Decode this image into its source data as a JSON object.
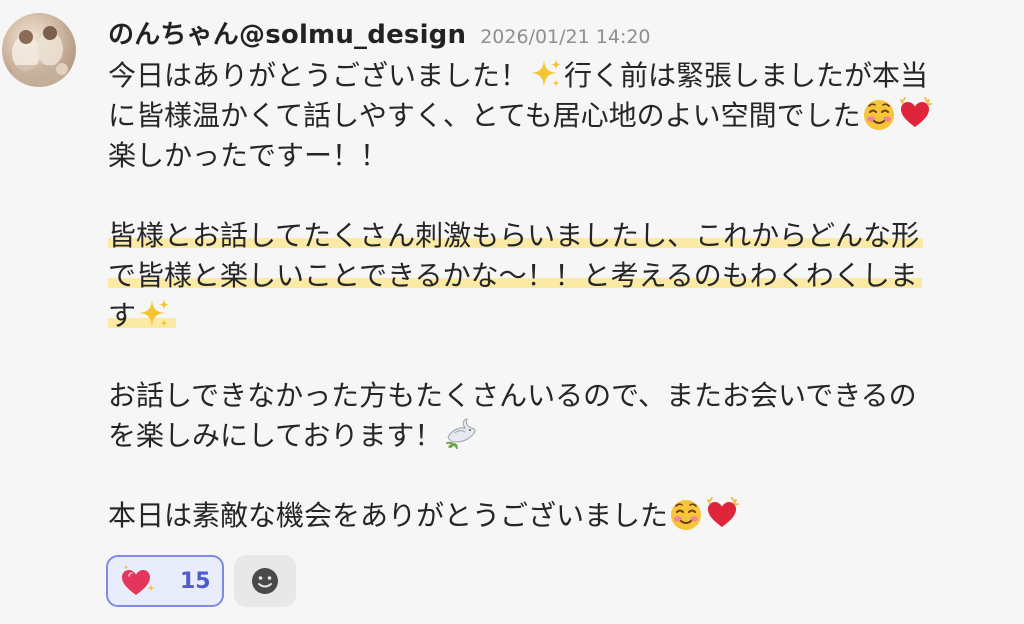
{
  "message": {
    "author": "のんちゃん@solmu_design",
    "timestamp": "2026/01/21 14:20",
    "paragraphs": {
      "p1_a": "今日はありがとうございました！",
      "p1_b": "行く前は緊張しましたが本当",
      "p1_c": "に皆様温かくて話しやすく、とても居心地のよい空間でした",
      "p1_d": "楽しかったですー！！",
      "p2_line1": "皆様とお話してたくさん刺激もらいましたし、これからどんな形",
      "p2_line2": "で皆様と楽しいことできるかな〜！！と考えるのもわくわくしま",
      "p2_line3": "す",
      "p3_line1": "お話しできなかった方もたくさんいるので、またお会いできるの",
      "p3_line2": "を楽しみにしております！",
      "p4": "本日は素敵な機会をありがとうございました"
    },
    "emojis": {
      "sparkles": "sparkles-icon",
      "smiling_face": "smiling-face-icon",
      "beating_heart": "beating-heart-icon",
      "dove": "dove-icon"
    }
  },
  "reactions": [
    {
      "icon": "sparkling-heart-icon",
      "count": "15",
      "selected": true
    },
    {
      "icon": "add-reaction-icon"
    }
  ],
  "colors": {
    "background": "#f7f6f6",
    "highlight": "#faeaa5",
    "reaction_border": "#7e8be2",
    "reaction_bg": "#e9ecfb",
    "reaction_count": "#4d5bce"
  }
}
